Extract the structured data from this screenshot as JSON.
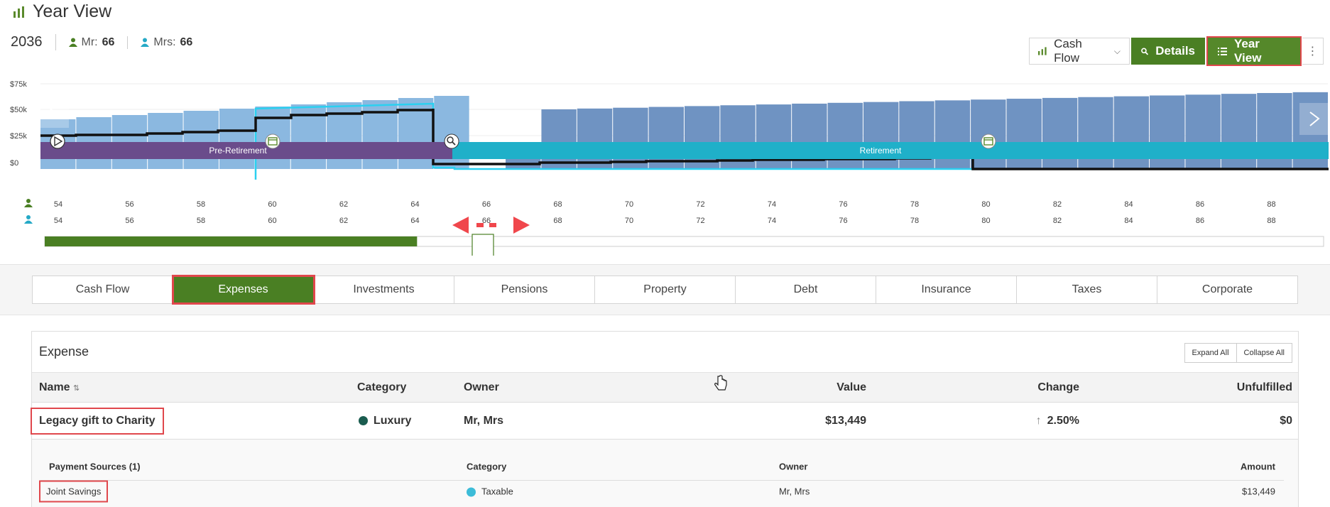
{
  "header": {
    "title": "Year View",
    "year": "2036",
    "mr_label": "Mr:",
    "mr_age": "66",
    "mrs_label": "Mrs:",
    "mrs_age": "66"
  },
  "toolbar": {
    "view_select": "Cash Flow",
    "details_label": "Details",
    "yearview_label": "Year View"
  },
  "chart": {
    "y_ticks": [
      "$75k",
      "$50k",
      "$25k",
      "$0"
    ],
    "band_pre": "Pre-Retirement",
    "band_ret": "Retirement",
    "ages_mr": [
      "54",
      "56",
      "58",
      "60",
      "62",
      "64",
      "66",
      "68",
      "70",
      "72",
      "74",
      "76",
      "78",
      "80",
      "82",
      "84",
      "86",
      "88"
    ],
    "ages_mrs": [
      "54",
      "56",
      "58",
      "60",
      "62",
      "64",
      "66",
      "68",
      "70",
      "72",
      "74",
      "76",
      "78",
      "80",
      "82",
      "84",
      "86",
      "88"
    ],
    "colors": {
      "pre_bar": "#8bb8e0",
      "ret_bar": "#6f93c2",
      "pre_band": "#6a4c8b",
      "ret_band": "#1fb0c9",
      "line": "#111111",
      "cyan": "#2bd0f0",
      "progress": "#4a7f23"
    },
    "progress_fraction": 0.33
  },
  "tabs": [
    "Cash Flow",
    "Expenses",
    "Investments",
    "Pensions",
    "Property",
    "Debt",
    "Insurance",
    "Taxes",
    "Corporate"
  ],
  "panel": {
    "title": "Expense",
    "expand_all": "Expand All",
    "collapse_all": "Collapse All",
    "columns": {
      "name": "Name",
      "category": "Category",
      "owner": "Owner",
      "value": "Value",
      "change": "Change",
      "unfulfilled": "Unfulfilled"
    },
    "row": {
      "name": "Legacy gift to Charity",
      "category": "Luxury",
      "category_color": "#1a5c4f",
      "owner": "Mr, Mrs",
      "value": "$13,449",
      "change": "2.50%",
      "unfulfilled": "$0"
    },
    "sub_columns": {
      "sources": "Payment Sources (1)",
      "category": "Category",
      "owner": "Owner",
      "amount": "Amount"
    },
    "sub_row": {
      "name": "Joint Savings",
      "category": "Taxable",
      "category_color": "#3cbcd8",
      "owner": "Mr, Mrs",
      "amount": "$13,449"
    }
  }
}
